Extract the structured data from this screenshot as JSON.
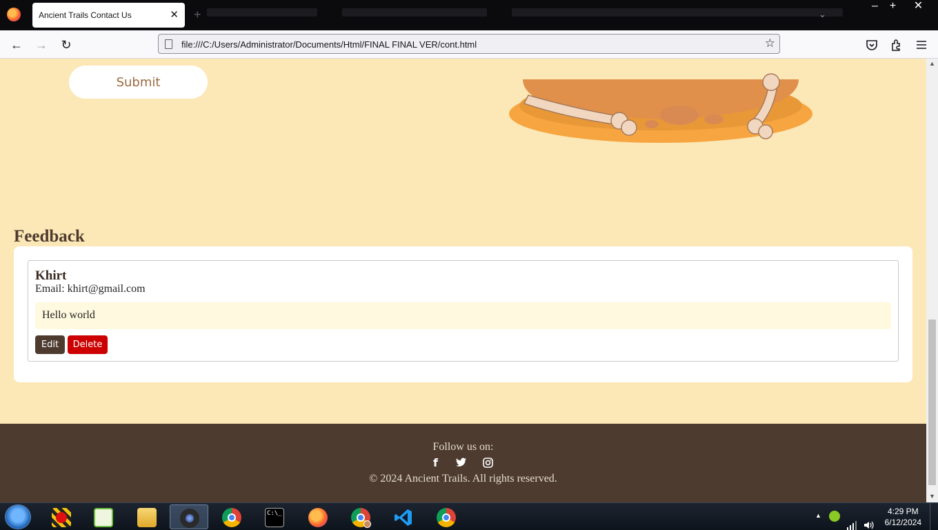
{
  "browser": {
    "tab_title": "Ancient Trails Contact Us",
    "url": "file:///C:/Users/Administrator/Documents/Html/FINAL FINAL VER/cont.html"
  },
  "page": {
    "submit_label": "Submit",
    "feedback_heading": "Feedback",
    "feedback": {
      "name": "Khirt",
      "email": "Email: khirt@gmail.com",
      "message": "Hello world",
      "edit_label": "Edit",
      "delete_label": "Delete"
    },
    "footer": {
      "follow_text": "Follow us on:",
      "copyright": "© 2024 Ancient Trails. All rights reserved.",
      "social_icons": [
        "facebook-icon",
        "twitter-icon",
        "instagram-icon"
      ]
    }
  },
  "taskbar": {
    "time": "4:29 PM",
    "date": "6/12/2024",
    "apps": [
      "recorder",
      "notepad",
      "file-explorer",
      "camera",
      "chrome",
      "command-prompt",
      "firefox",
      "chrome-profile",
      "vscode",
      "chrome"
    ]
  },
  "colors": {
    "page_bg": "#fce8b6",
    "footer_bg": "#4d3b30",
    "delete_red": "#cc0000",
    "message_bg": "#fffadf"
  }
}
